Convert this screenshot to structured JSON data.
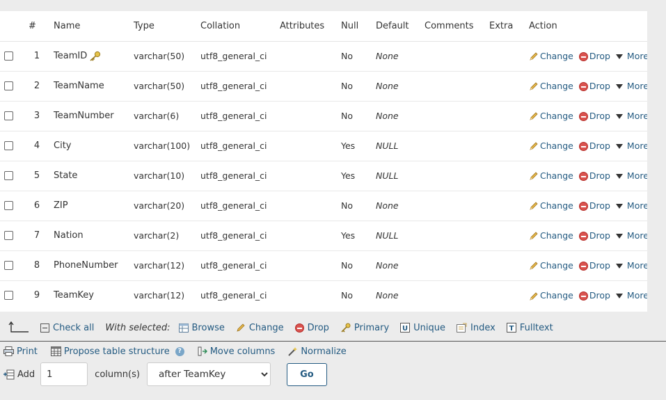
{
  "table": {
    "headers": [
      "#",
      "Name",
      "Type",
      "Collation",
      "Attributes",
      "Null",
      "Default",
      "Comments",
      "Extra",
      "Action"
    ],
    "rows": [
      {
        "num": "1",
        "name": "TeamID",
        "type": "varchar(50)",
        "collation": "utf8_general_ci",
        "attributes": "",
        "null": "No",
        "default": "None",
        "comments": "",
        "extra": "",
        "primary_key": true
      },
      {
        "num": "2",
        "name": "TeamName",
        "type": "varchar(50)",
        "collation": "utf8_general_ci",
        "attributes": "",
        "null": "No",
        "default": "None",
        "comments": "",
        "extra": ""
      },
      {
        "num": "3",
        "name": "TeamNumber",
        "type": "varchar(6)",
        "collation": "utf8_general_ci",
        "attributes": "",
        "null": "No",
        "default": "None",
        "comments": "",
        "extra": ""
      },
      {
        "num": "4",
        "name": "City",
        "type": "varchar(100)",
        "collation": "utf8_general_ci",
        "attributes": "",
        "null": "Yes",
        "default": "NULL",
        "comments": "",
        "extra": ""
      },
      {
        "num": "5",
        "name": "State",
        "type": "varchar(10)",
        "collation": "utf8_general_ci",
        "attributes": "",
        "null": "Yes",
        "default": "NULL",
        "comments": "",
        "extra": ""
      },
      {
        "num": "6",
        "name": "ZIP",
        "type": "varchar(20)",
        "collation": "utf8_general_ci",
        "attributes": "",
        "null": "No",
        "default": "None",
        "comments": "",
        "extra": ""
      },
      {
        "num": "7",
        "name": "Nation",
        "type": "varchar(2)",
        "collation": "utf8_general_ci",
        "attributes": "",
        "null": "Yes",
        "default": "NULL",
        "comments": "",
        "extra": ""
      },
      {
        "num": "8",
        "name": "PhoneNumber",
        "type": "varchar(12)",
        "collation": "utf8_general_ci",
        "attributes": "",
        "null": "No",
        "default": "None",
        "comments": "",
        "extra": ""
      },
      {
        "num": "9",
        "name": "TeamKey",
        "type": "varchar(12)",
        "collation": "utf8_general_ci",
        "attributes": "",
        "null": "No",
        "default": "None",
        "comments": "",
        "extra": ""
      }
    ],
    "row_actions": {
      "change": "Change",
      "drop": "Drop",
      "more": "More"
    }
  },
  "selection": {
    "check_all": "Check all",
    "with_selected": "With selected:",
    "browse": "Browse",
    "change": "Change",
    "drop": "Drop",
    "primary": "Primary",
    "unique": "Unique",
    "index": "Index",
    "fulltext": "Fulltext"
  },
  "tools": {
    "print": "Print",
    "propose": "Propose table structure",
    "move_columns": "Move columns",
    "normalize": "Normalize"
  },
  "add_column": {
    "label": "Add",
    "count": "1",
    "columns_label": "column(s)",
    "position": "after TeamKey",
    "go": "Go"
  },
  "colors": {
    "link": "#235a81",
    "drop_red": "#d9534f",
    "background": "#ececec"
  }
}
